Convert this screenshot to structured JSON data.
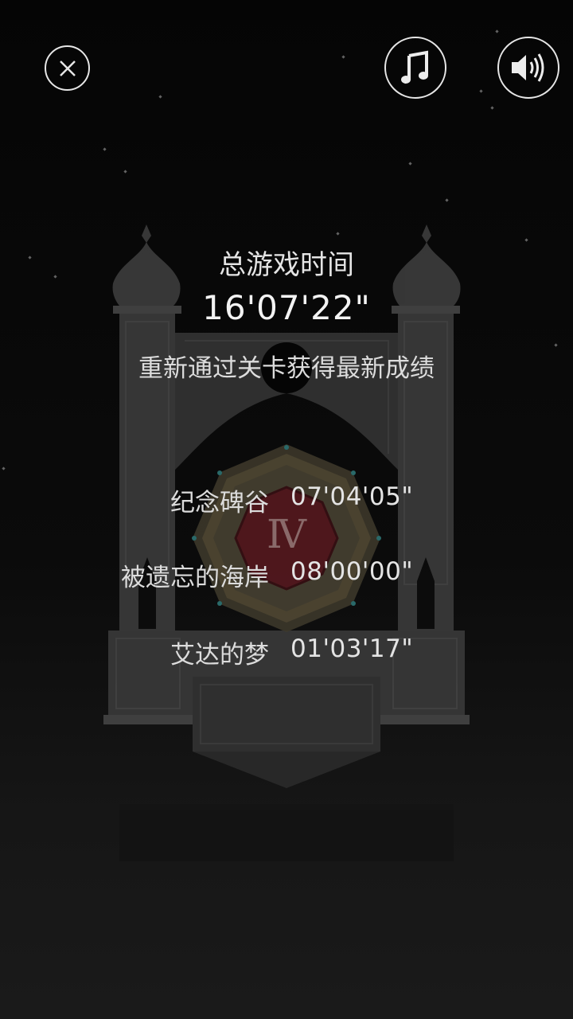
{
  "controls": {
    "close_icon": "close-icon",
    "music_icon": "music-note-icon",
    "sound_icon": "speaker-icon"
  },
  "summary": {
    "title": "总游戏时间",
    "total_time": "16'07'22\"",
    "hint": "重新通过关卡获得最新成绩"
  },
  "chapters": [
    {
      "name": "纪念碑谷",
      "time": "07'04'05\""
    },
    {
      "name": "被遗忘的海岸",
      "time": "08'00'00\""
    },
    {
      "name": "艾达的梦",
      "time": "01'03'17\""
    }
  ],
  "emblem": {
    "numeral": "Ⅳ"
  },
  "colors": {
    "background": "#080808",
    "tower": "#3a3a3a",
    "emblem_red": "#5a1a20",
    "emblem_gold": "#5d5540",
    "text": "#e4e4e4"
  }
}
